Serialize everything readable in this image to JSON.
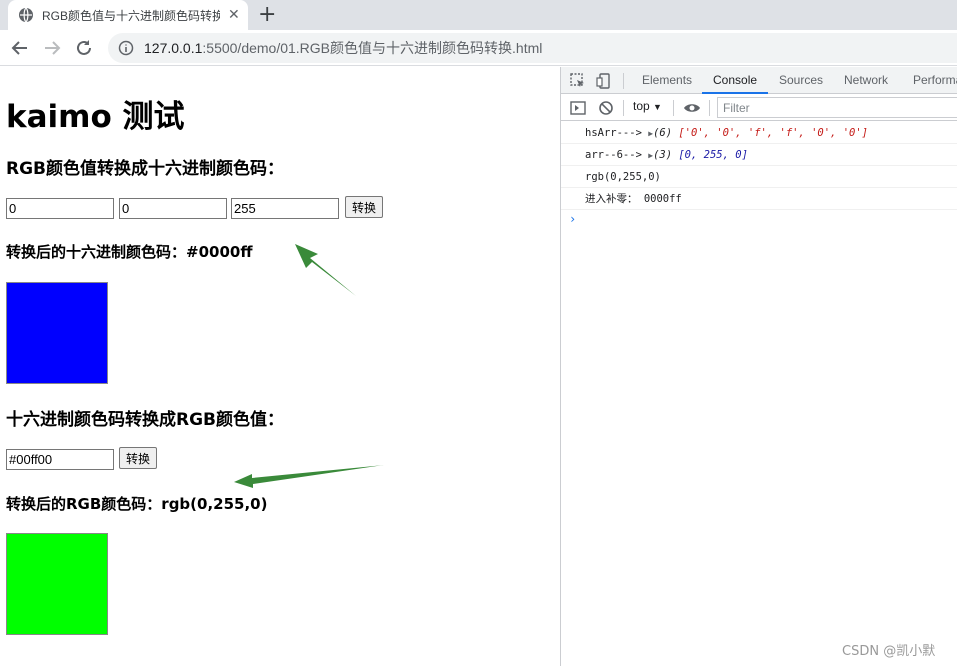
{
  "browser": {
    "tab_title": "RGB颜色值与十六进制颜色码转换",
    "tab_close": "✕",
    "new_tab": "+",
    "url_host": "127.0.0.1",
    "url_path": ":5500/demo/01.RGB颜色值与十六进制颜色码转换.html"
  },
  "page": {
    "title": "kaimo 测试",
    "section1": {
      "heading": "RGB颜色值转换成十六进制颜色码：",
      "inputs": [
        "0",
        "0",
        "255"
      ],
      "button": "转换",
      "result": "转换后的十六进制颜色码：#0000ff",
      "swatch_color": "#0000ff"
    },
    "section2": {
      "heading": "十六进制颜色码转换成RGB颜色值：",
      "input": "#00ff00",
      "button": "转换",
      "result": "转换后的RGB颜色码：rgb(0,255,0)",
      "swatch_color": "#00ff00"
    },
    "arrow_color": "#3a8a3a"
  },
  "devtools": {
    "tabs": [
      "Elements",
      "Console",
      "Sources",
      "Network",
      "Performa"
    ],
    "active_tab": "Console",
    "context": "top",
    "filter_placeholder": "Filter",
    "console": [
      {
        "label": "hsArr--->",
        "count": "(6)",
        "value": "['0', '0', 'f', 'f', '0', '0']"
      },
      {
        "label": "arr--6-->",
        "count": "(3)",
        "value": "[0, 255, 0]"
      },
      {
        "text": "rgb(0,255,0)"
      },
      {
        "text": "进入补零： 0000ff"
      }
    ],
    "prompt": "›"
  },
  "watermark": "CSDN @凯小默"
}
